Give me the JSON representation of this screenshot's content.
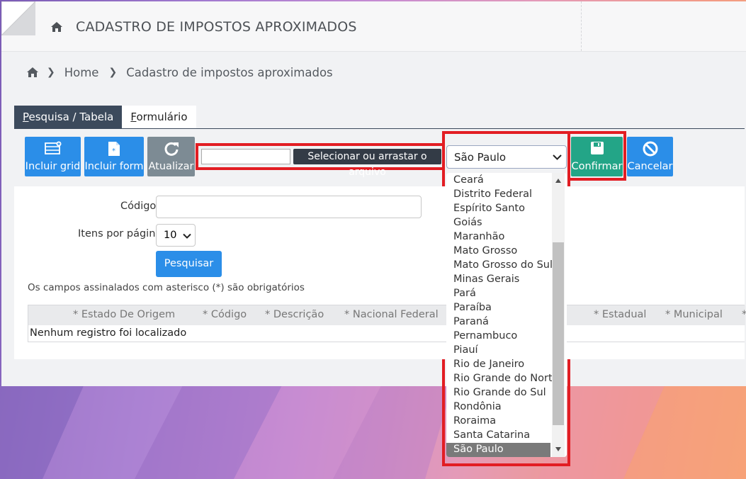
{
  "header": {
    "title": "CADASTRO DE IMPOSTOS APROXIMADOS",
    "icon": "home-icon"
  },
  "breadcrumb": {
    "home_icon": "home-icon",
    "home": "Home",
    "current": "Cadastro de impostos aproximados"
  },
  "tabs": [
    {
      "label_first": "P",
      "label_rest": "esquisa / Tabela",
      "active": true
    },
    {
      "label_first": "F",
      "label_rest": "ormulário",
      "active": false
    }
  ],
  "toolbar": {
    "incluir_grid": "Incluir grid",
    "incluir_form": "Incluir form",
    "atualizar": "Atualizar",
    "file_button": "Selecionar ou arrastar o arquivo",
    "state_selected": "São Paulo",
    "confirmar": "Confirmar",
    "cancelar": "Cancelar"
  },
  "form": {
    "codigo_label": "Código",
    "codigo_value": "",
    "itens_label": "Itens por página",
    "itens_value": "10",
    "pesquisar": "Pesquisar",
    "required_note": "Os campos assinalados com asterisco (*) são obrigatórios"
  },
  "grid": {
    "columns": [
      "* Estado De Origem",
      "* Código",
      "* Descrição",
      "* Nacional Federal",
      "* Estadual",
      "* Municipal",
      "*"
    ],
    "empty_message": "Nenhum registro foi localizado"
  },
  "dropdown": {
    "options": [
      "Ceará",
      "Distrito Federal",
      "Espírito Santo",
      "Goiás",
      "Maranhão",
      "Mato Grosso",
      "Mato Grosso do Sul",
      "Minas Gerais",
      "Pará",
      "Paraíba",
      "Paraná",
      "Pernambuco",
      "Piauí",
      "Rio de Janeiro",
      "Rio Grande do Norte",
      "Rio Grande do Sul",
      "Rondônia",
      "Roraima",
      "Santa Catarina"
    ],
    "selected": "São Paulo"
  },
  "colors": {
    "primary": "#2b8ee8",
    "gray_button": "#7d8b94",
    "confirm": "#23a587",
    "highlight": "#e21d23",
    "tab_active": "#3c4a5c"
  }
}
